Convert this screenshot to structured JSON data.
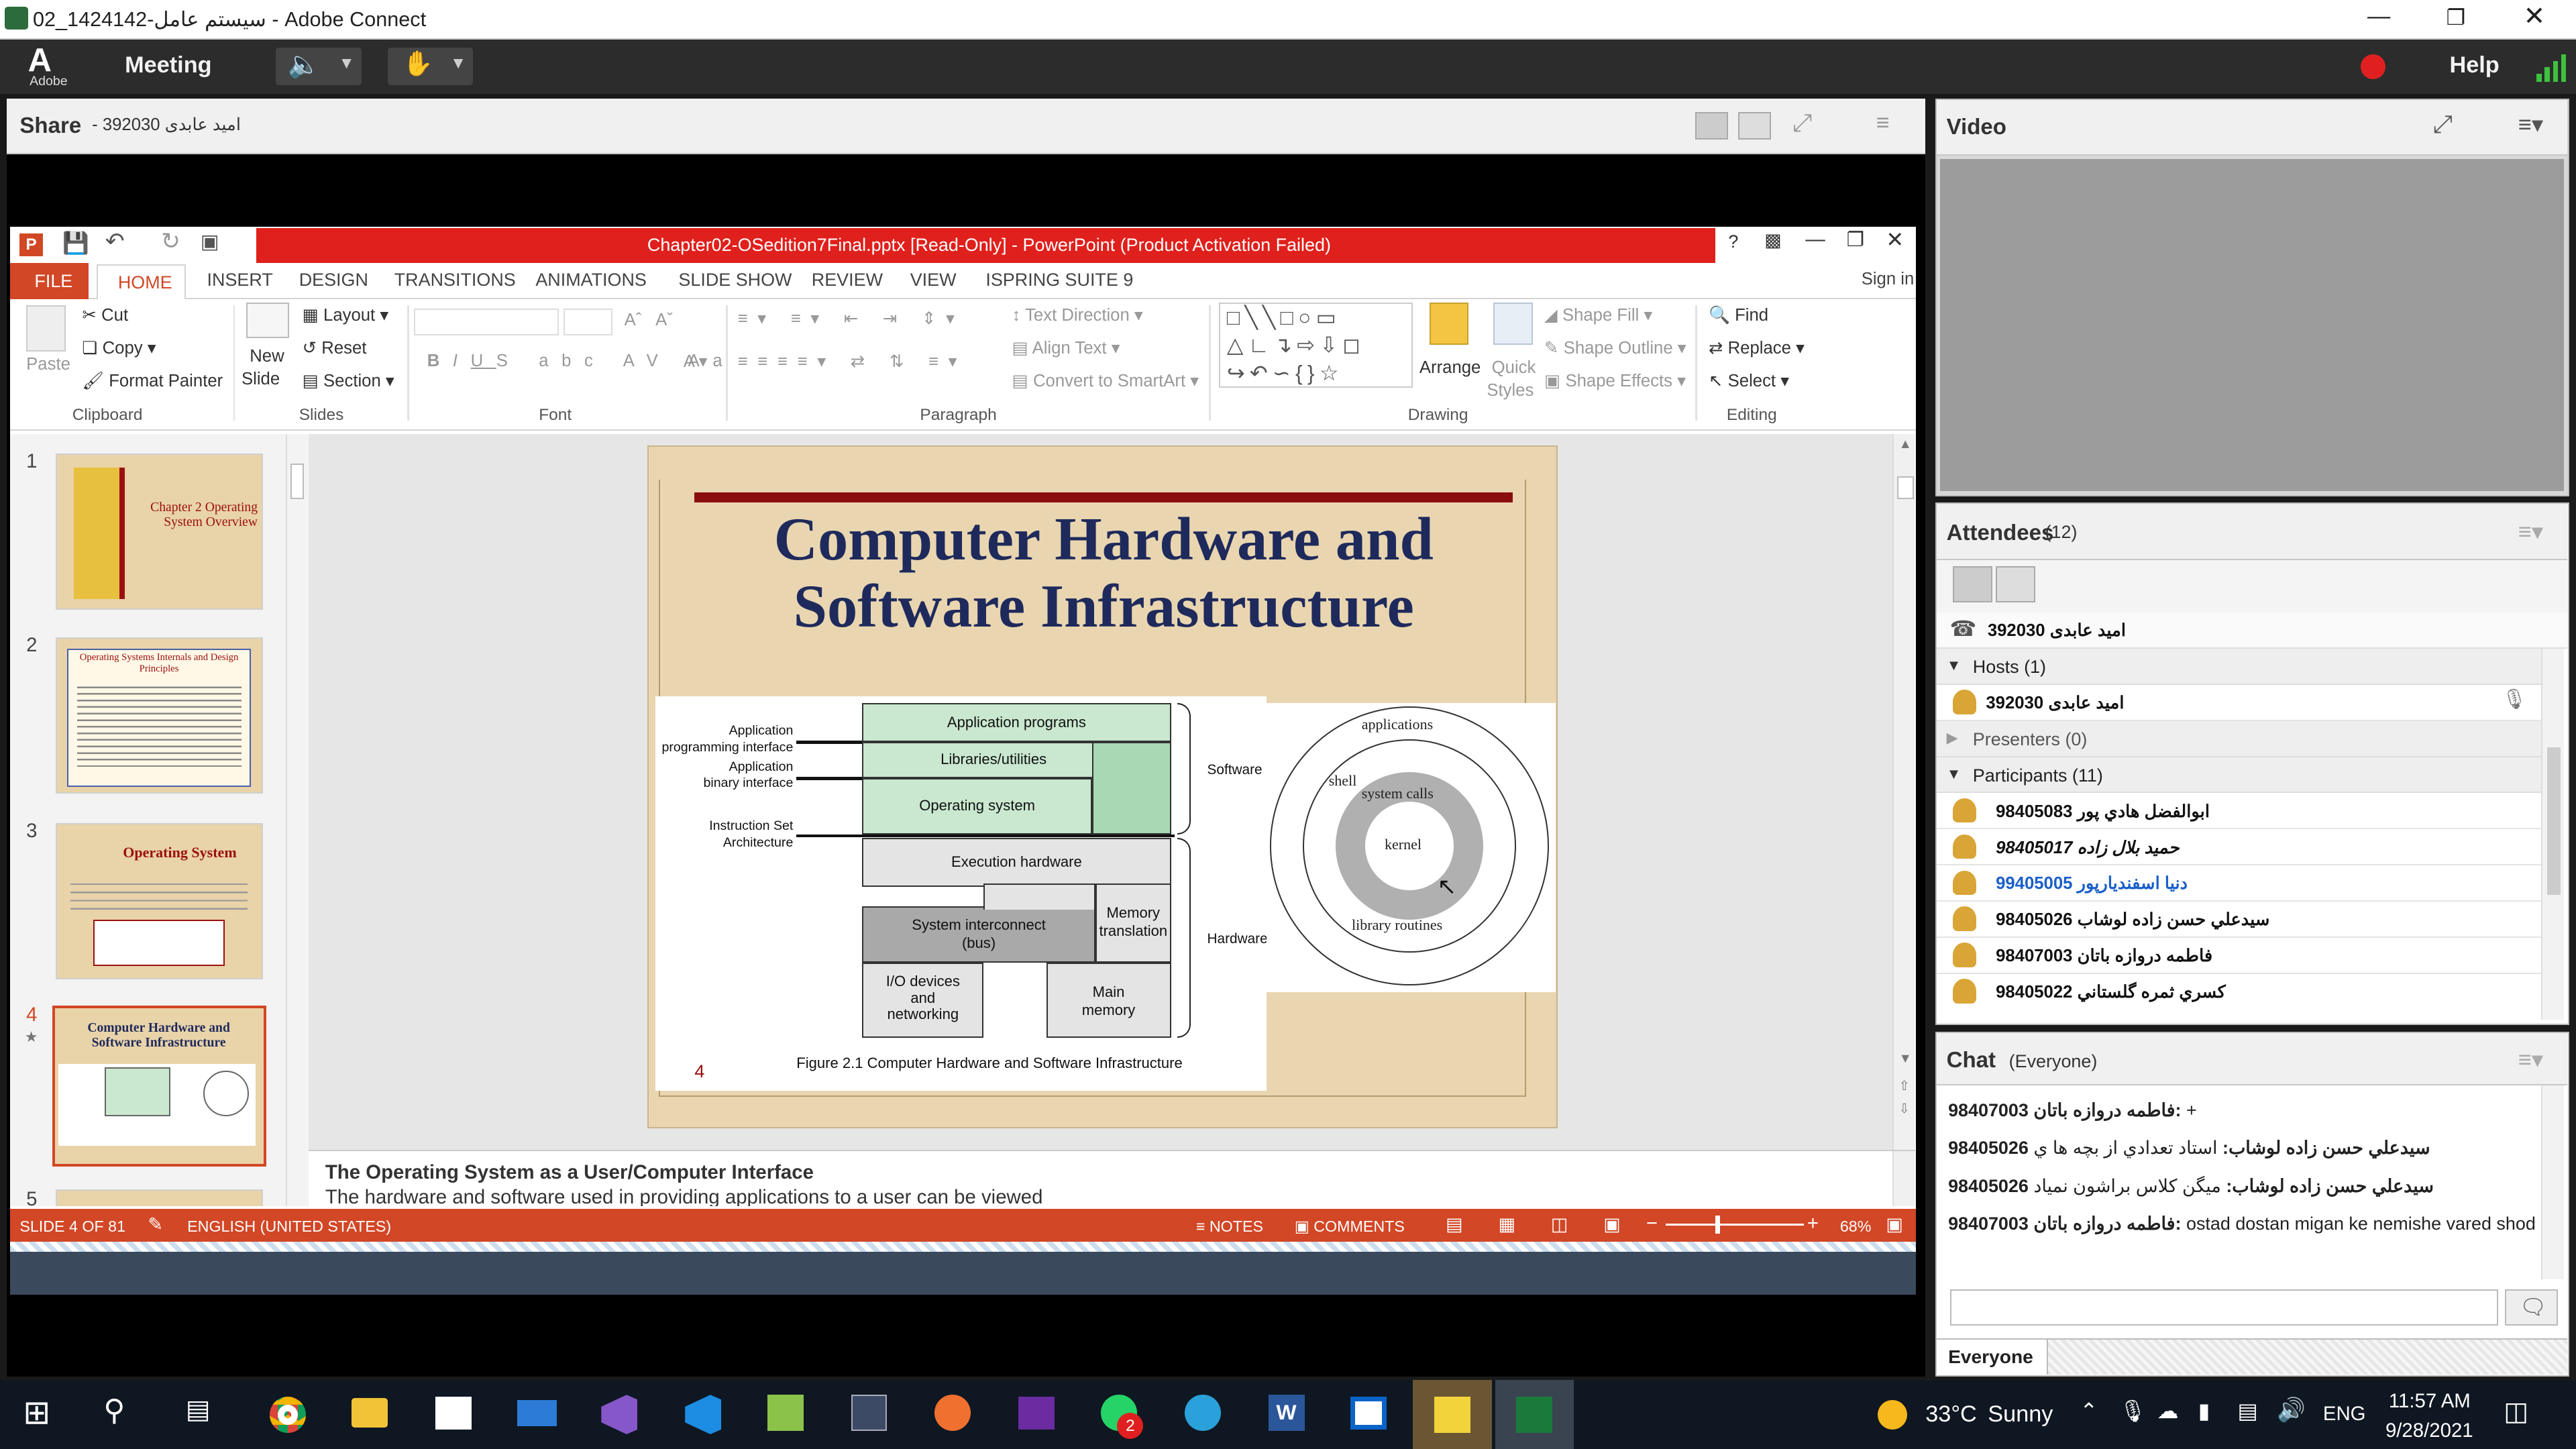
{
  "window": {
    "title": "02_1424142-سیستم عامل - Adobe Connect"
  },
  "adobe_bar": {
    "logo_text": "Adobe",
    "meeting_label": "Meeting",
    "help_label": "Help"
  },
  "share_pod": {
    "title": "Share",
    "presenter": "- 392030 امید عابدی"
  },
  "video_pod": {
    "title": "Video"
  },
  "attendees_pod": {
    "title": "Attendees",
    "count": "(12)",
    "me": "392030 امید عابدی",
    "hosts_label": "Hosts (1)",
    "host": "392030 امید عابدی",
    "presenters_label": "Presenters (0)",
    "participants_label": "Participants (11)",
    "participants": [
      "98405083 ابوالفضل هادي پور",
      "98405017 حميد بلال زاده",
      "99405005 دنيا اسفنديارپور",
      "98405026 سيدعلي حسن زاده لوشاب",
      "98407003 فاطمه دروازه باتان",
      "98405022 کسري ثمره گلستاني"
    ]
  },
  "chat_pod": {
    "title": "Chat",
    "scope": "(Everyone)",
    "messages": [
      {
        "sender": "98407003 فاطمه دروازه باتان:",
        "text": " +"
      },
      {
        "sender": "98405026 سيدعلي حسن زاده لوشاب:",
        "text": " استاد تعدادي از بچه ها ي"
      },
      {
        "sender": "98405026 سيدعلي حسن زاده لوشاب:",
        "text": " ميگن کلاس براشون نمياد"
      },
      {
        "sender": "98407003 فاطمه دروازه باتان:",
        "text": " ostad dostan migan ke nemishe vared shod"
      }
    ],
    "input_placeholder": "",
    "tab_label": "Everyone"
  },
  "powerpoint": {
    "title": "Chapter02-OSedition7Final.pptx [Read-Only] - PowerPoint (Product Activation Failed)",
    "tabs": [
      "FILE",
      "HOME",
      "INSERT",
      "DESIGN",
      "TRANSITIONS",
      "ANIMATIONS",
      "SLIDE SHOW",
      "REVIEW",
      "VIEW",
      "ISPRING SUITE 9"
    ],
    "sign_in": "Sign in",
    "ribbon": {
      "paste": "Paste",
      "cut": "Cut",
      "copy": "Copy",
      "format_painter": "Format Painter",
      "new_slide": "New",
      "new_slide2": "Slide",
      "layout": "Layout",
      "reset": "Reset",
      "section": "Section",
      "text_direction": "Text Direction",
      "align_text": "Align Text",
      "convert_smartart": "Convert to SmartArt",
      "arrange": "Arrange",
      "quick_styles": "Quick",
      "quick_styles2": "Styles",
      "shape_fill": "Shape Fill",
      "shape_outline": "Shape Outline",
      "shape_effects": "Shape Effects",
      "find": "Find",
      "replace": "Replace",
      "select": "Select",
      "groups": [
        "Clipboard",
        "Slides",
        "Font",
        "Paragraph",
        "Drawing",
        "Editing"
      ]
    },
    "thumbs": [
      {
        "num": "1",
        "title": "Chapter 2 Operating System Overview"
      },
      {
        "num": "2",
        "title": "Operating Systems Internals and Design Principles"
      },
      {
        "num": "3",
        "title": "Operating System"
      },
      {
        "num": "4",
        "title": "Computer Hardware and Software Infrastructure"
      },
      {
        "num": "5",
        "title": ""
      }
    ],
    "slide": {
      "title_line1": "Computer Hardware and",
      "title_line2": "Software Infrastructure",
      "page_num": "4",
      "caption": "Figure 2.1 Computer Hardware and Software Infrastructure",
      "left_labels": [
        "Application",
        "programming interface",
        "Application",
        "binary interface",
        "Instruction Set",
        "Architecture"
      ],
      "boxes": [
        "Application programs",
        "Libraries/utilities",
        "Operating system",
        "Execution hardware",
        "System interconnect",
        "(bus)",
        "Memory",
        "translation",
        "I/O devices",
        "and",
        "networking",
        "Main",
        "memory"
      ],
      "software_label": "Software",
      "hardware_label": "Hardware",
      "rings": [
        "applications",
        "shell",
        "system calls",
        "kernel",
        "library routines"
      ]
    },
    "notes": {
      "heading": "The Operating System as a User/Computer Interface",
      "body": "The hardware and software used in providing applications to a user can be viewed"
    },
    "status": {
      "slide": "SLIDE 4 OF 81",
      "lang": "ENGLISH (UNITED STATES)",
      "notes": "NOTES",
      "comments": "COMMENTS",
      "zoom": "68%"
    }
  },
  "taskbar": {
    "weather_temp": "33°C",
    "weather_text": "Sunny",
    "lang": "ENG",
    "time": "11:57 AM",
    "date": "9/28/2021",
    "whatsapp_badge": "2"
  },
  "colors": {
    "ppt_red": "#d24726",
    "title_red": "#e0201c",
    "slide_navy": "#1f2a5c",
    "adobe_dark": "#2c2c2c"
  }
}
